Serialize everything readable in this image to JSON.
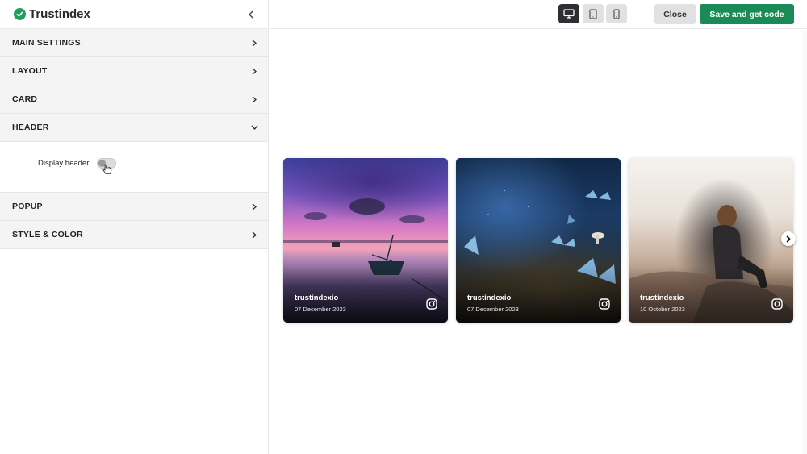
{
  "brand": {
    "name": "Trustindex",
    "color": "#1f9e5a"
  },
  "sidebar": {
    "sections": [
      {
        "label": "MAIN SETTINGS",
        "open": false
      },
      {
        "label": "LAYOUT",
        "open": false
      },
      {
        "label": "CARD",
        "open": false
      },
      {
        "label": "HEADER",
        "open": true
      },
      {
        "label": "POPUP",
        "open": false
      },
      {
        "label": "STYLE & COLOR",
        "open": false
      }
    ],
    "header_options": {
      "display_header_label": "Display header",
      "display_header_on": false
    }
  },
  "toolbar": {
    "devices": [
      "desktop-icon",
      "tablet-icon",
      "mobile-icon"
    ],
    "active_device": "desktop",
    "close_label": "Close",
    "save_label": "Save and get code",
    "save_color": "#1b8b55"
  },
  "cards": [
    {
      "user": "trustindexio",
      "date": "07 December 2023",
      "icon": "instagram-icon"
    },
    {
      "user": "trustindexio",
      "date": "07 December 2023",
      "icon": "instagram-icon"
    },
    {
      "user": "trustindexio",
      "date": "10 October 2023",
      "icon": "instagram-icon"
    }
  ]
}
